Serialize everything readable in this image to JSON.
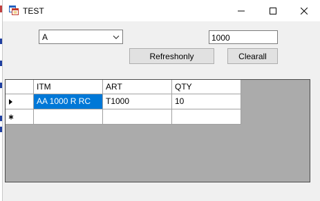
{
  "window": {
    "title": "TEST"
  },
  "combo": {
    "selected": "A"
  },
  "textbox": {
    "value": "1000"
  },
  "buttons": {
    "refresh": "Refreshonly",
    "clear": "Clearall"
  },
  "grid": {
    "columns": [
      "ITM",
      "ART",
      "QTY"
    ],
    "rows": [
      {
        "ITM": "AA 1000 R RC",
        "ART": "T1000",
        "QTY": "10"
      }
    ],
    "row_header_current": "▶",
    "row_header_new": "*"
  },
  "colors": {
    "selection": "#0078d7",
    "grid_background": "#ababab"
  }
}
